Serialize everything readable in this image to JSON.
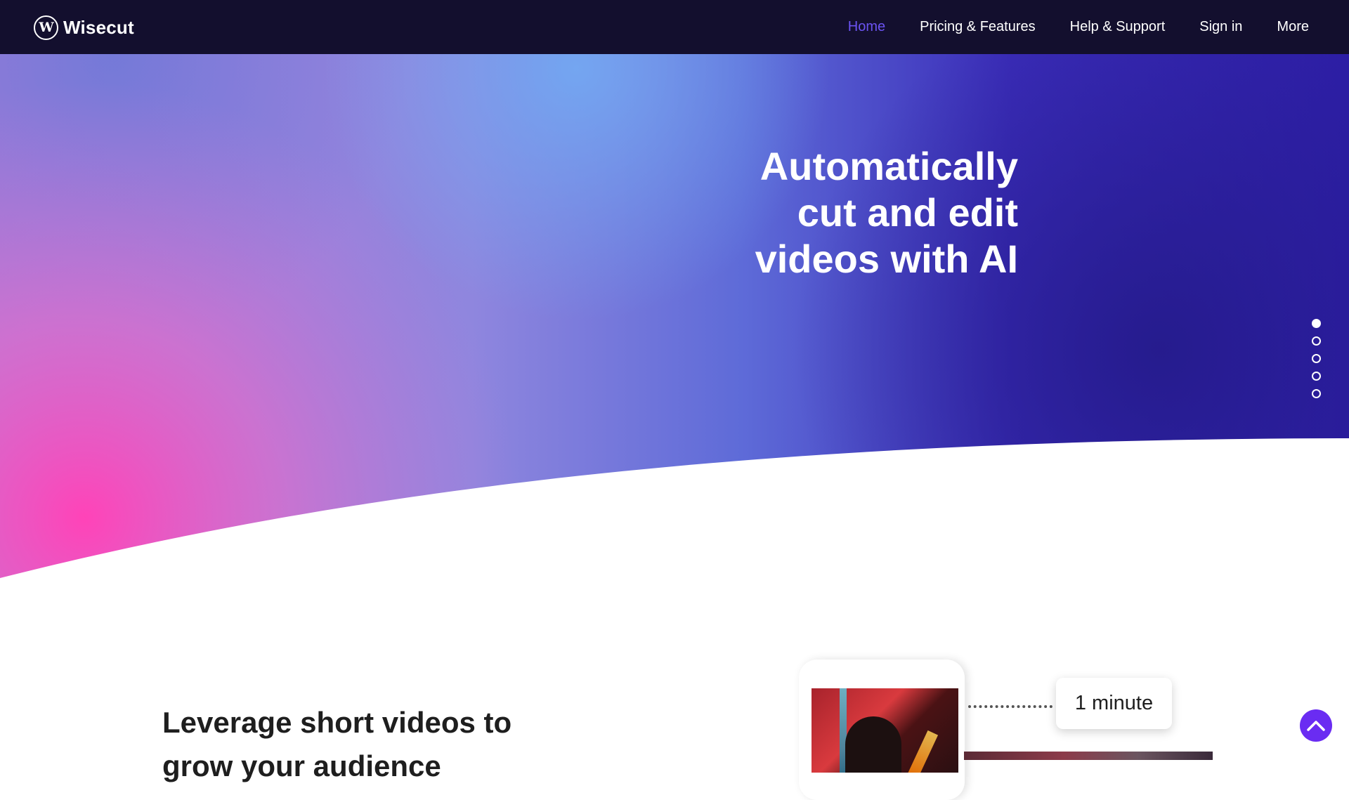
{
  "nav": {
    "brand": "Wisecut",
    "items": [
      {
        "label": "Home",
        "active": true
      },
      {
        "label": "Pricing & Features",
        "active": false
      },
      {
        "label": "Help & Support",
        "active": false
      },
      {
        "label": "Sign in",
        "active": false
      },
      {
        "label": "More",
        "active": false
      }
    ],
    "active_color": "#6b53f2",
    "background": "#130f2e"
  },
  "hero": {
    "heading": "Automatically\ncut and edit\nvideos with AI",
    "slide_count": 5,
    "active_slide": 1,
    "gradient_colors": [
      "#fb4bb8",
      "#9c8be0",
      "#6c9cee",
      "#2c1e9e"
    ]
  },
  "section2": {
    "heading": "Leverage short videos to grow your audience",
    "duration_badge": "1 minute"
  },
  "back_to_top": {
    "icon": "chevron-up-icon",
    "color": "#6a2cf2"
  }
}
